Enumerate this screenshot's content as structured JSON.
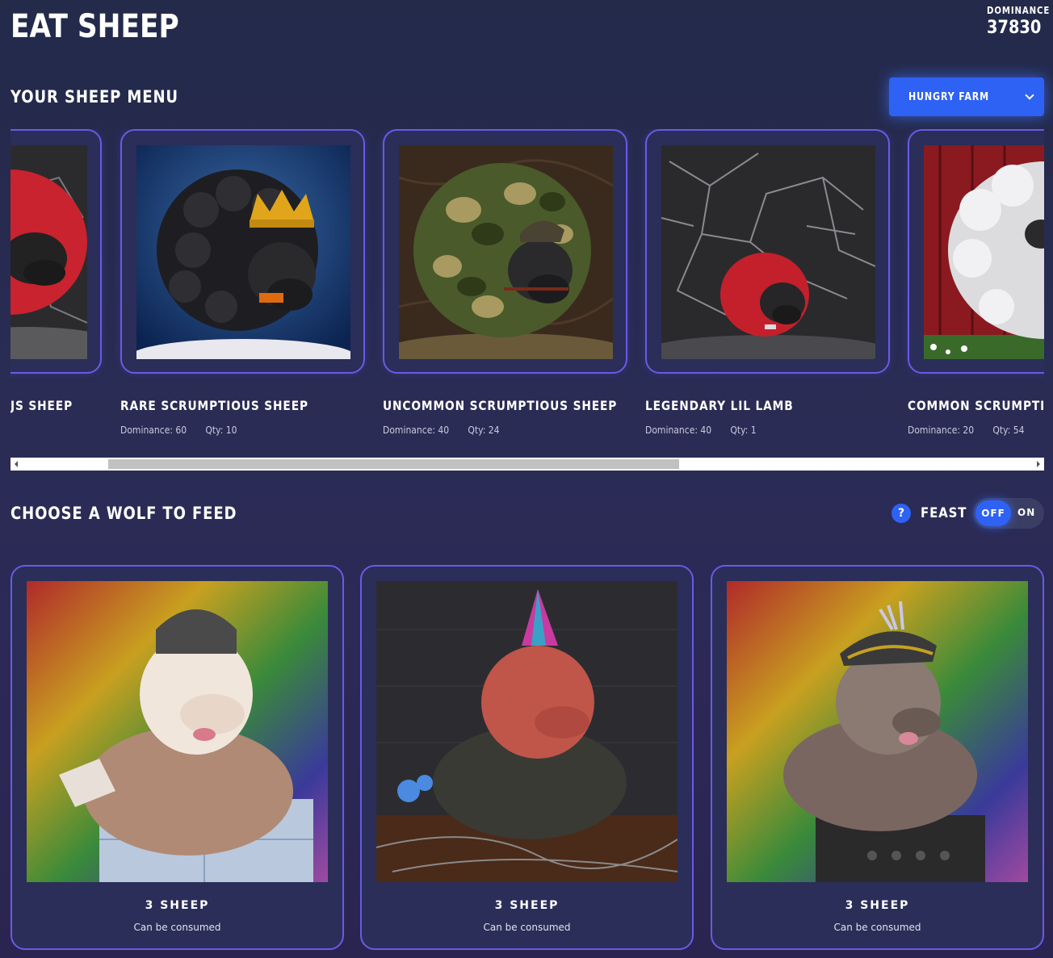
{
  "header": {
    "title": "EAT SHEEP",
    "dominance_label": "DOMINANCE",
    "dominance_value": "37830"
  },
  "sheep_menu": {
    "title": "YOUR SHEEP MENU",
    "farm_select": "HUNGRY FARM",
    "cards": [
      {
        "name": "JS SHEEP",
        "dominance": "",
        "qty": ""
      },
      {
        "name": "RARE SCRUMPTIOUS SHEEP",
        "dominance": "Dominance: 60",
        "qty": "Qty: 10"
      },
      {
        "name": "UNCOMMON SCRUMPTIOUS SHEEP",
        "dominance": "Dominance: 40",
        "qty": "Qty: 24"
      },
      {
        "name": "LEGENDARY LIL LAMB",
        "dominance": "Dominance: 40",
        "qty": "Qty: 1"
      },
      {
        "name": "COMMON SCRUMPTIOU",
        "dominance": "Dominance: 20",
        "qty": "Qty: 54"
      }
    ],
    "scroll_fraction": 0.55
  },
  "wolf_section": {
    "title": "CHOOSE A WOLF TO FEED",
    "help": "?",
    "feast_label": "FEAST",
    "toggle_off": "OFF",
    "toggle_on": "ON",
    "toggle_state": "OFF",
    "wolves": [
      {
        "count": "3 SHEEP",
        "note": "Can be consumed"
      },
      {
        "count": "3 SHEEP",
        "note": "Can be consumed"
      },
      {
        "count": "3 SHEEP",
        "note": "Can be consumed"
      }
    ]
  },
  "colors": {
    "accent": "#2e62f5",
    "card_border": "#6a5ae6",
    "background": "#262a50"
  }
}
